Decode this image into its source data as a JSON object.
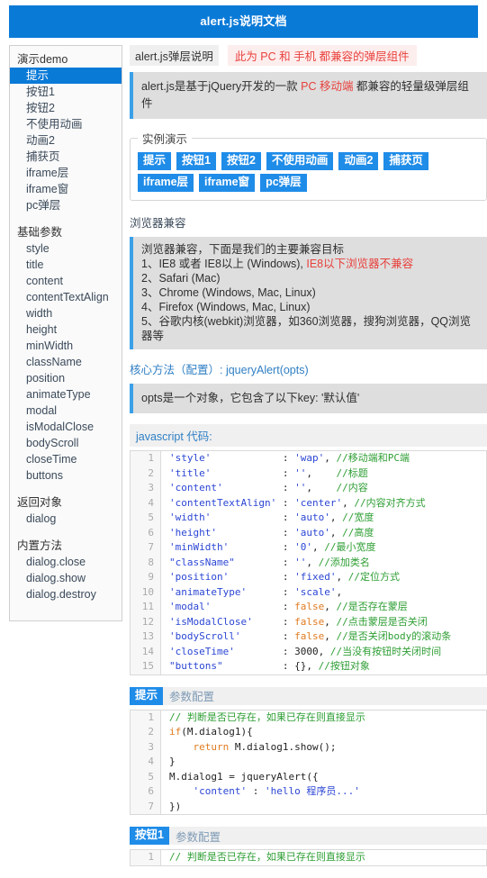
{
  "header": {
    "title": "alert.js说明文档"
  },
  "sidebar": {
    "groups": [
      {
        "title": "演示demo",
        "items": [
          {
            "label": "提示",
            "active": true
          },
          {
            "label": "按钮1",
            "active": false
          },
          {
            "label": "按钮2",
            "active": false
          },
          {
            "label": "不使用动画",
            "active": false
          },
          {
            "label": "动画2",
            "active": false
          },
          {
            "label": "捕获页",
            "active": false
          },
          {
            "label": "iframe层",
            "active": false
          },
          {
            "label": "iframe窗",
            "active": false
          },
          {
            "label": "pc弹层",
            "active": false
          }
        ]
      },
      {
        "title": "基础参数",
        "items": [
          {
            "label": "style",
            "active": false
          },
          {
            "label": "title",
            "active": false
          },
          {
            "label": "content",
            "active": false
          },
          {
            "label": "contentTextAlign",
            "active": false
          },
          {
            "label": "width",
            "active": false
          },
          {
            "label": "height",
            "active": false
          },
          {
            "label": "minWidth",
            "active": false
          },
          {
            "label": "className",
            "active": false
          },
          {
            "label": "position",
            "active": false
          },
          {
            "label": "animateType",
            "active": false
          },
          {
            "label": "modal",
            "active": false
          },
          {
            "label": "isModalClose",
            "active": false
          },
          {
            "label": "bodyScroll",
            "active": false
          },
          {
            "label": "closeTime",
            "active": false
          },
          {
            "label": "buttons",
            "active": false
          }
        ]
      },
      {
        "title": "返回对象",
        "items": [
          {
            "label": "dialog",
            "active": false
          }
        ]
      },
      {
        "title": "内置方法",
        "items": [
          {
            "label": "dialog.close",
            "active": false
          },
          {
            "label": "dialog.show",
            "active": false
          },
          {
            "label": "dialog.destroy",
            "active": false
          }
        ]
      }
    ]
  },
  "main": {
    "intro_tag": "alert.js弹层说明",
    "intro_badge": "此为 PC 和 手机 都兼容的弹层组件",
    "intro_quote": {
      "pre": "alert.js是基于jQuery开发的一款 ",
      "hl1": "PC 移动端",
      "post": " 都兼容的轻量级弹层组件"
    },
    "demo_legend": "实例演示",
    "demo_buttons": [
      "提示",
      "按钮1",
      "按钮2",
      "不使用动画",
      "动画2",
      "捕获页",
      "iframe层",
      "iframe窗",
      "pc弹层"
    ],
    "compat_title": "浏览器兼容",
    "compat_lines": {
      "l0": "浏览器兼容，下面是我们的主要兼容目标",
      "l1_pre": "1、IE8 或者 IE8以上 (Windows), ",
      "l1_hl": "IE8以下浏览器不兼容",
      "l2": "2、Safari (Mac)",
      "l3": "3、Chrome (Windows, Mac, Linux)",
      "l4": "4、Firefox (Windows, Mac, Linux)",
      "l5": "5、谷歌内核(webkit)浏览器，如360浏览器，搜狗浏览器，QQ浏览器等"
    },
    "core_title": "核心方法（配置）: jqueryAlert(opts)",
    "core_quote": "opts是一个对象，它包含了以下key: '默认值'",
    "js_code_label": "javascript 代码:",
    "code_opts": [
      {
        "n": "1",
        "tokens": [
          {
            "t": "str",
            "v": "'style'"
          },
          {
            "t": "pun",
            "v": "            : "
          },
          {
            "t": "str",
            "v": "'wap'"
          },
          {
            "t": "pun",
            "v": ","
          },
          {
            "t": "com",
            "v": " //移动端和PC端"
          }
        ]
      },
      {
        "n": "2",
        "tokens": [
          {
            "t": "str",
            "v": "'title'"
          },
          {
            "t": "pun",
            "v": "            : "
          },
          {
            "t": "str",
            "v": "''"
          },
          {
            "t": "pun",
            "v": ","
          },
          {
            "t": "com",
            "v": "    //标题"
          }
        ]
      },
      {
        "n": "3",
        "tokens": [
          {
            "t": "str",
            "v": "'content'"
          },
          {
            "t": "pun",
            "v": "          : "
          },
          {
            "t": "str",
            "v": "''"
          },
          {
            "t": "pun",
            "v": ","
          },
          {
            "t": "com",
            "v": "    //内容"
          }
        ]
      },
      {
        "n": "4",
        "tokens": [
          {
            "t": "str",
            "v": "'contentTextAlign'"
          },
          {
            "t": "pun",
            "v": " : "
          },
          {
            "t": "str",
            "v": "'center'"
          },
          {
            "t": "pun",
            "v": ","
          },
          {
            "t": "com",
            "v": " //内容对齐方式"
          }
        ]
      },
      {
        "n": "5",
        "tokens": [
          {
            "t": "str",
            "v": "'width'"
          },
          {
            "t": "pun",
            "v": "            : "
          },
          {
            "t": "str",
            "v": "'auto'"
          },
          {
            "t": "pun",
            "v": ","
          },
          {
            "t": "com",
            "v": " //宽度"
          }
        ]
      },
      {
        "n": "6",
        "tokens": [
          {
            "t": "str",
            "v": "'height'"
          },
          {
            "t": "pun",
            "v": "           : "
          },
          {
            "t": "str",
            "v": "'auto'"
          },
          {
            "t": "pun",
            "v": ","
          },
          {
            "t": "com",
            "v": " //高度"
          }
        ]
      },
      {
        "n": "7",
        "tokens": [
          {
            "t": "str",
            "v": "'minWidth'"
          },
          {
            "t": "pun",
            "v": "         : "
          },
          {
            "t": "str",
            "v": "'0'"
          },
          {
            "t": "pun",
            "v": ","
          },
          {
            "t": "com",
            "v": " //最小宽度"
          }
        ]
      },
      {
        "n": "8",
        "tokens": [
          {
            "t": "str",
            "v": "\"className\""
          },
          {
            "t": "pun",
            "v": "        : "
          },
          {
            "t": "str",
            "v": "''"
          },
          {
            "t": "pun",
            "v": ","
          },
          {
            "t": "com",
            "v": " //添加类名"
          }
        ]
      },
      {
        "n": "9",
        "tokens": [
          {
            "t": "str",
            "v": "'position'"
          },
          {
            "t": "pun",
            "v": "         : "
          },
          {
            "t": "str",
            "v": "'fixed'"
          },
          {
            "t": "pun",
            "v": ","
          },
          {
            "t": "com",
            "v": " //定位方式"
          }
        ]
      },
      {
        "n": "10",
        "tokens": [
          {
            "t": "str",
            "v": "'animateType'"
          },
          {
            "t": "pun",
            "v": "      : "
          },
          {
            "t": "str",
            "v": "'scale'"
          },
          {
            "t": "pun",
            "v": ","
          },
          {
            "t": "com",
            "v": ""
          }
        ]
      },
      {
        "n": "11",
        "tokens": [
          {
            "t": "str",
            "v": "'modal'"
          },
          {
            "t": "pun",
            "v": "            : "
          },
          {
            "t": "key",
            "v": "false"
          },
          {
            "t": "pun",
            "v": ","
          },
          {
            "t": "com",
            "v": " //是否存在蒙层"
          }
        ]
      },
      {
        "n": "12",
        "tokens": [
          {
            "t": "str",
            "v": "'isModalClose'"
          },
          {
            "t": "pun",
            "v": "     : "
          },
          {
            "t": "key",
            "v": "false"
          },
          {
            "t": "pun",
            "v": ","
          },
          {
            "t": "com",
            "v": " //点击蒙层是否关闭"
          }
        ]
      },
      {
        "n": "13",
        "tokens": [
          {
            "t": "str",
            "v": "'bodyScroll'"
          },
          {
            "t": "pun",
            "v": "       : "
          },
          {
            "t": "key",
            "v": "false"
          },
          {
            "t": "pun",
            "v": ","
          },
          {
            "t": "com",
            "v": " //是否关闭body的滚动条"
          }
        ]
      },
      {
        "n": "14",
        "tokens": [
          {
            "t": "str",
            "v": "'closeTime'"
          },
          {
            "t": "pun",
            "v": "        : "
          },
          {
            "t": "num",
            "v": "3000"
          },
          {
            "t": "pun",
            "v": ","
          },
          {
            "t": "com",
            "v": " //当没有按钮时关闭时间"
          }
        ]
      },
      {
        "n": "15",
        "tokens": [
          {
            "t": "str",
            "v": "\"buttons\""
          },
          {
            "t": "pun",
            "v": "          : "
          },
          {
            "t": "pun",
            "v": "{},"
          },
          {
            "t": "com",
            "v": " //按钮对象"
          }
        ]
      }
    ],
    "section_tip": {
      "tag": "提示",
      "sub": "参数配置"
    },
    "code_tip": [
      {
        "n": "1",
        "tokens": [
          {
            "t": "com",
            "v": "// 判断是否已存在，如果已存在则直接显示"
          }
        ]
      },
      {
        "n": "2",
        "tokens": [
          {
            "t": "key",
            "v": "if"
          },
          {
            "t": "pun",
            "v": "(M.dialog1){"
          }
        ]
      },
      {
        "n": "3",
        "tokens": [
          {
            "t": "pun",
            "v": "    "
          },
          {
            "t": "key",
            "v": "return"
          },
          {
            "t": "pun",
            "v": " M.dialog1.show();"
          }
        ]
      },
      {
        "n": "4",
        "tokens": [
          {
            "t": "pun",
            "v": "}"
          }
        ]
      },
      {
        "n": "5",
        "tokens": [
          {
            "t": "pun",
            "v": "M.dialog1 = jqueryAlert({"
          }
        ]
      },
      {
        "n": "6",
        "tokens": [
          {
            "t": "pun",
            "v": "    "
          },
          {
            "t": "str",
            "v": "'content'"
          },
          {
            "t": "pun",
            "v": " : "
          },
          {
            "t": "str",
            "v": "'hello 程序员...'"
          }
        ]
      },
      {
        "n": "7",
        "tokens": [
          {
            "t": "pun",
            "v": "})"
          }
        ]
      }
    ],
    "section_btn1": {
      "tag": "按钮1",
      "sub": "参数配置"
    },
    "code_btn1": [
      {
        "n": "1",
        "tokens": [
          {
            "t": "com",
            "v": "// 判断是否已存在，如果已存在则直接显示"
          }
        ]
      }
    ]
  }
}
